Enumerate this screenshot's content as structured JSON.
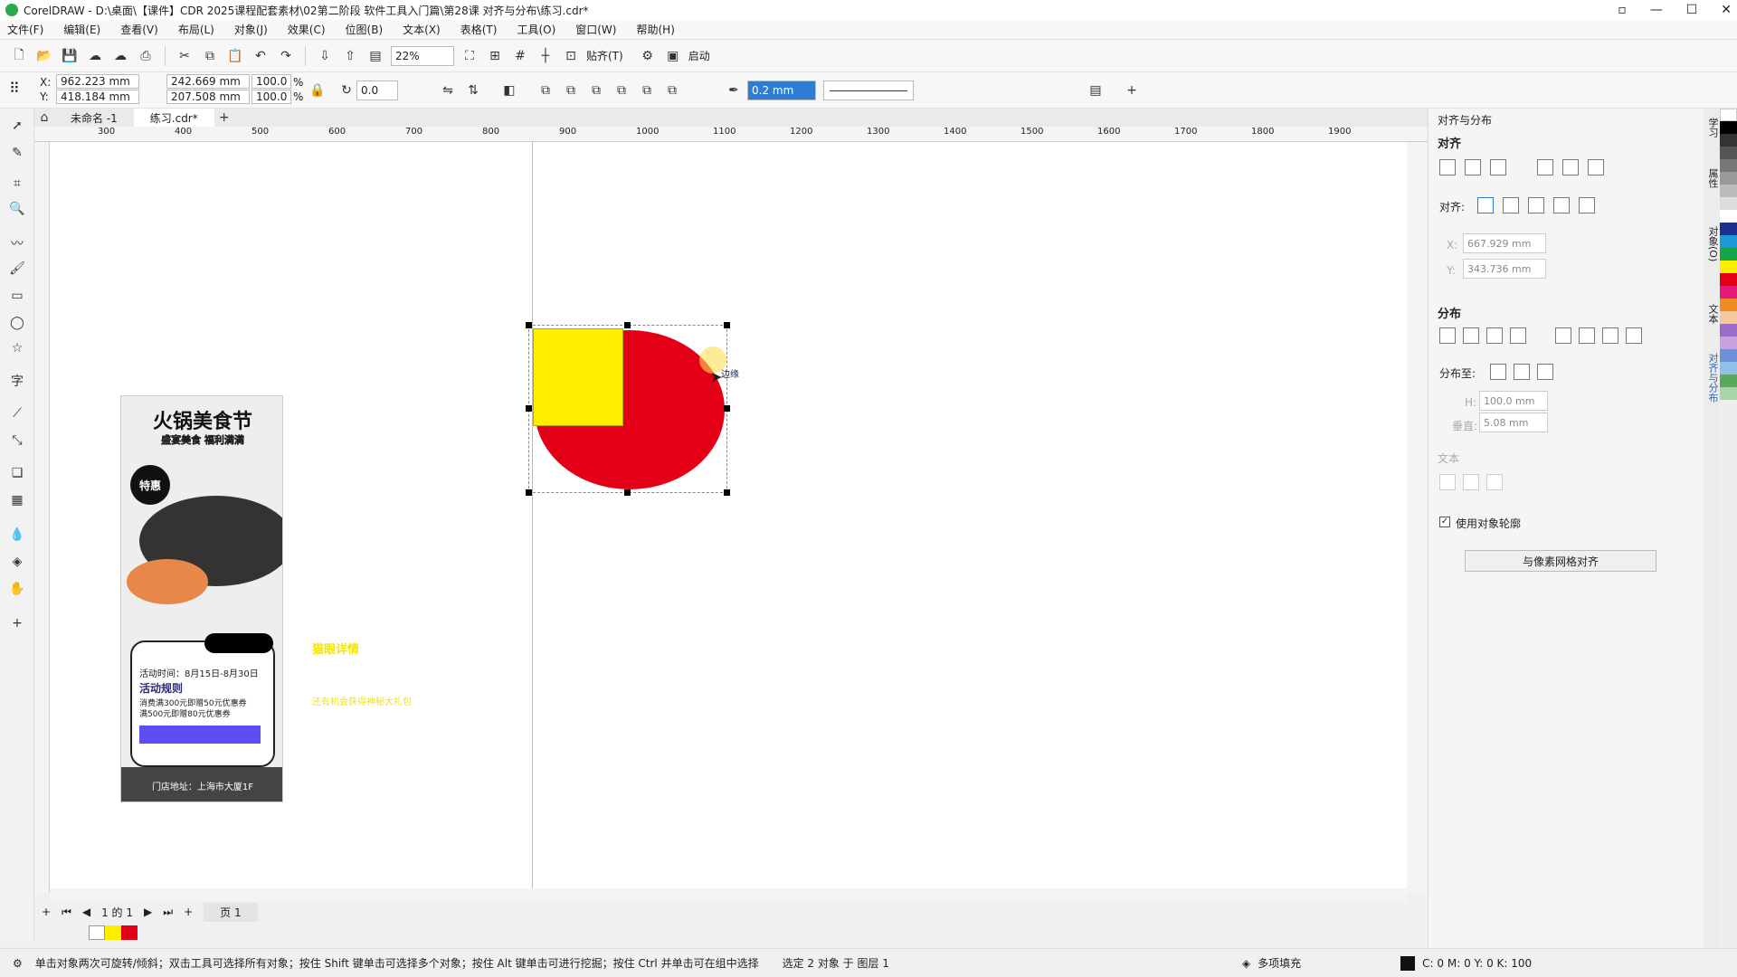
{
  "window": {
    "title": "CorelDRAW - D:\\桌面\\【课件】CDR 2025课程配套素材\\02第二阶段 软件工具入门篇\\第28课 对齐与分布\\练习.cdr*"
  },
  "menu": [
    "文件(F)",
    "编辑(E)",
    "查看(V)",
    "布局(L)",
    "对象(J)",
    "效果(C)",
    "位图(B)",
    "文本(X)",
    "表格(T)",
    "工具(O)",
    "窗口(W)",
    "帮助(H)"
  ],
  "toolbar": {
    "zoom": "22%",
    "snap": "贴齐(T)",
    "launch": "启动"
  },
  "propbar": {
    "x": "962.223 mm",
    "y": "418.184 mm",
    "w": "242.669 mm",
    "h": "207.508 mm",
    "sx": "100.0",
    "sy": "100.0",
    "pct": "%",
    "rotate": "0.0",
    "outline": "0.2 mm"
  },
  "tabs": [
    "未命名 -1",
    "练习.cdr*"
  ],
  "ruler": [
    "300",
    "400",
    "500",
    "600",
    "700",
    "800",
    "900",
    "1000",
    "1100",
    "1200",
    "1300",
    "1400",
    "1500",
    "1600",
    "1700",
    "1800",
    "1900"
  ],
  "canvas": {
    "hint": "边缘",
    "caption1": "猫眼详情",
    "caption2": "还有机会获得神秘大礼包"
  },
  "poster": {
    "title": "火锅美食节",
    "subtitle": "盛宴美食 福利满满",
    "badge": "特惠",
    "time": "活动时间：8月15日-8月30日",
    "rules_title": "活动规则",
    "rule1": "消费满300元即赠50元优惠券",
    "rule2": "满500元即赠80元优惠券",
    "address": "门店地址：上海市大厦1F"
  },
  "pages": {
    "info": "1 的 1",
    "page": "页 1"
  },
  "status": {
    "hint": "单击对象两次可旋转/倾斜；双击工具可选择所有对象；按住 Shift 键单击可选择多个对象；按住 Alt 键单击可进行挖掘；按住 Ctrl 并单击可在组中选择",
    "selection": "选定 2 对象 于 图层 1",
    "fill": "多项填充",
    "color": "C: 0 M: 0 Y: 0 K: 100"
  },
  "panel": {
    "title": "对齐与分布",
    "align": "对齐",
    "align_to": "对齐:",
    "x": "667.929 mm",
    "y": "343.736 mm",
    "dist": "分布",
    "dist_to": "分布至:",
    "h": "100.0 mm",
    "gap": "5.08 mm",
    "text": "文本",
    "use_outline": "使用对象轮廓",
    "grid_btn": "与像素网格对齐",
    "xl": "X:",
    "yl": "Y:",
    "hl": "H:",
    "gl": "垂直:"
  },
  "sidetabs": [
    "学习",
    "属性",
    "对象(O)",
    "文本",
    "对齐与分布"
  ],
  "colors": {
    "yellow": "#FFED00",
    "red": "#E30016"
  }
}
